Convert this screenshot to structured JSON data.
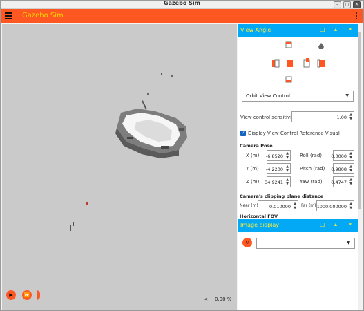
{
  "window": {
    "title": "Gazebo Sim"
  },
  "app": {
    "title": "Gazebo Sim"
  },
  "viewport": {
    "rtf_value": "0.00 %",
    "rtf_prev": "<"
  },
  "view_angle": {
    "title": "View Angle",
    "control_select": "Orbit View Control",
    "sensitivity_label": "View control sensitivity",
    "sensitivity_value": "1.00",
    "reference_visual_label": "Display View Control Reference Visual",
    "reference_visual_checked": true,
    "camera_pose_heading": "Camera Pose",
    "pose": {
      "x_label": "X (m)",
      "x": "-6.8520",
      "y_label": "Y (m)",
      "y": "-4.2200",
      "z_label": "Z (m)",
      "z": "34.9241",
      "roll_label": "Roll (rad)",
      "roll": "0.0000",
      "pitch_label": "Pitch (rad)",
      "pitch": "0.9808",
      "yaw_label": "Yaw (rad)",
      "yaw": "0.4747"
    },
    "clip_heading": "Camera's clipping plane distance",
    "near_label": "Near (m)",
    "near": "0.010000",
    "far_label": "Far (m)",
    "far": "1000.000000",
    "fov_heading": "Horizontal FOV"
  },
  "image_display": {
    "title": "Image display",
    "topic": ""
  },
  "colors": {
    "accent": "#ff5722",
    "panel_header": "#03a9f4",
    "title_text": "#f6d600"
  }
}
